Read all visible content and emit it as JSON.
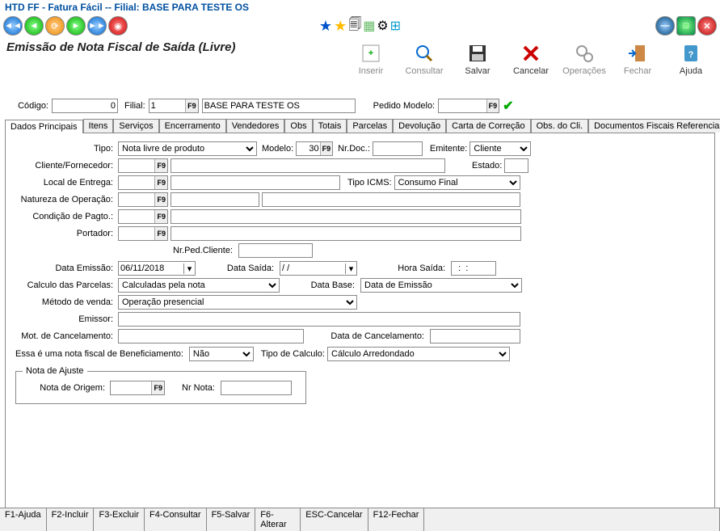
{
  "window": {
    "title": "HTD FF - Fatura Fácil  --   Filial: BASE PARA TESTE OS",
    "subtitle": "Emissão de Nota Fiscal de Saída (Livre)"
  },
  "toolbar": {
    "inserir": "Inserir",
    "consultar": "Consultar",
    "salvar": "Salvar",
    "cancelar": "Cancelar",
    "operacoes": "Operações",
    "fechar": "Fechar",
    "ajuda": "Ajuda"
  },
  "header": {
    "codigo_label": "Código:",
    "codigo_value": "0",
    "filial_label": "Filial:",
    "filial_value": "1",
    "filial_desc": "BASE PARA TESTE OS",
    "pedido_modelo_label": "Pedido Modelo:",
    "pedido_modelo_value": ""
  },
  "tabs": {
    "dados_principais": "Dados Principais",
    "itens": "Itens",
    "servicos": "Serviços",
    "encerramento": "Encerramento",
    "vendedores": "Vendedores",
    "obs": "Obs",
    "totais": "Totais",
    "parcelas": "Parcelas",
    "devolucao": "Devolução",
    "carta_correcao": "Carta de Correção",
    "obs_cli": "Obs. do Cli.",
    "doc_fiscais": "Documentos Fiscais Referencia"
  },
  "form": {
    "tipo_label": "Tipo:",
    "tipo_value": "Nota livre de produto",
    "modelo_label": "Modelo:",
    "modelo_value": "30",
    "nr_doc_label": "Nr.Doc.:",
    "nr_doc_value": "",
    "emitente_label": "Emitente:",
    "emitente_value": "Cliente",
    "cliente_fornecedor_label": "Cliente/Fornecedor:",
    "estado_label": "Estado:",
    "local_entrega_label": "Local de Entrega:",
    "tipo_icms_label": "Tipo ICMS:",
    "tipo_icms_value": "Consumo Final",
    "natureza_label": "Natureza de Operação:",
    "condicao_pagto_label": "Condição de Pagto.:",
    "portador_label": "Portador:",
    "nr_ped_cliente_label": "Nr.Ped.Cliente:",
    "data_emissao_label": "Data Emissão:",
    "data_emissao_value": "06/11/2018",
    "data_saida_label": "Data Saída:",
    "data_saida_value": "  /  /",
    "hora_saida_label": "Hora Saída:",
    "hora_saida_value": "  :  :",
    "calculo_parcelas_label": "Calculo das Parcelas:",
    "calculo_parcelas_value": "Calculadas pela nota",
    "data_base_label": "Data Base:",
    "data_base_value": "Data de Emissão",
    "metodo_venda_label": "Método de venda:",
    "metodo_venda_value": "Operação presencial",
    "emissor_label": "Emissor:",
    "mot_cancelamento_label": "Mot. de Cancelamento:",
    "data_cancelamento_label": "Data de Cancelamento:",
    "beneficiamento_label": "Essa é uma nota fiscal de Beneficiamento:",
    "beneficiamento_value": "Não",
    "tipo_calculo_label": "Tipo de Calculo:",
    "tipo_calculo_value": "Cálculo Arredondado",
    "nota_ajuste_legend": "Nota de Ajuste",
    "nota_origem_label": "Nota de Origem:",
    "nr_nota_label": "Nr Nota:"
  },
  "statusbar": {
    "f1": "F1-Ajuda",
    "f2": "F2-Incluir",
    "f3": "F3-Excluir",
    "f4": "F4-Consultar",
    "f5": "F5-Salvar",
    "f6": "F6-Alterar",
    "esc": "ESC-Cancelar",
    "f12": "F12-Fechar"
  }
}
